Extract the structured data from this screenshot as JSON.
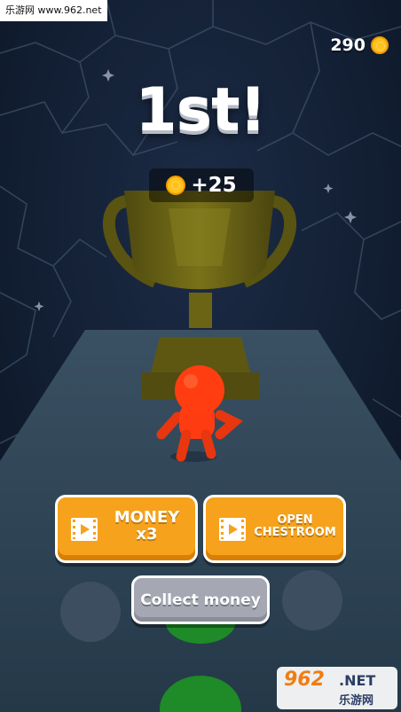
{
  "watermark": {
    "top_text": "乐游网 www.962.net",
    "logo_big": "962",
    "logo_net": ".NET",
    "logo_cn": "乐游网"
  },
  "hud": {
    "coins": "290",
    "coin_icon": "coin-icon"
  },
  "result": {
    "place_text": "1st!",
    "reward_text": "+25"
  },
  "buttons": {
    "money_multiplier": {
      "line1": "MONEY",
      "line2": "x3",
      "icon": "video-ad-icon"
    },
    "open_chestroom": {
      "line1": "OPEN",
      "line2": "CHESTROOM",
      "icon": "video-ad-icon"
    },
    "collect": {
      "label": "Collect money"
    }
  },
  "colors": {
    "background": "#0f1a2e",
    "platform": "#2f4354",
    "accent_orange": "#f6a21c",
    "player": "#ff3b12",
    "trophy": "#6b6414",
    "button_gray": "#a5a8b3"
  }
}
